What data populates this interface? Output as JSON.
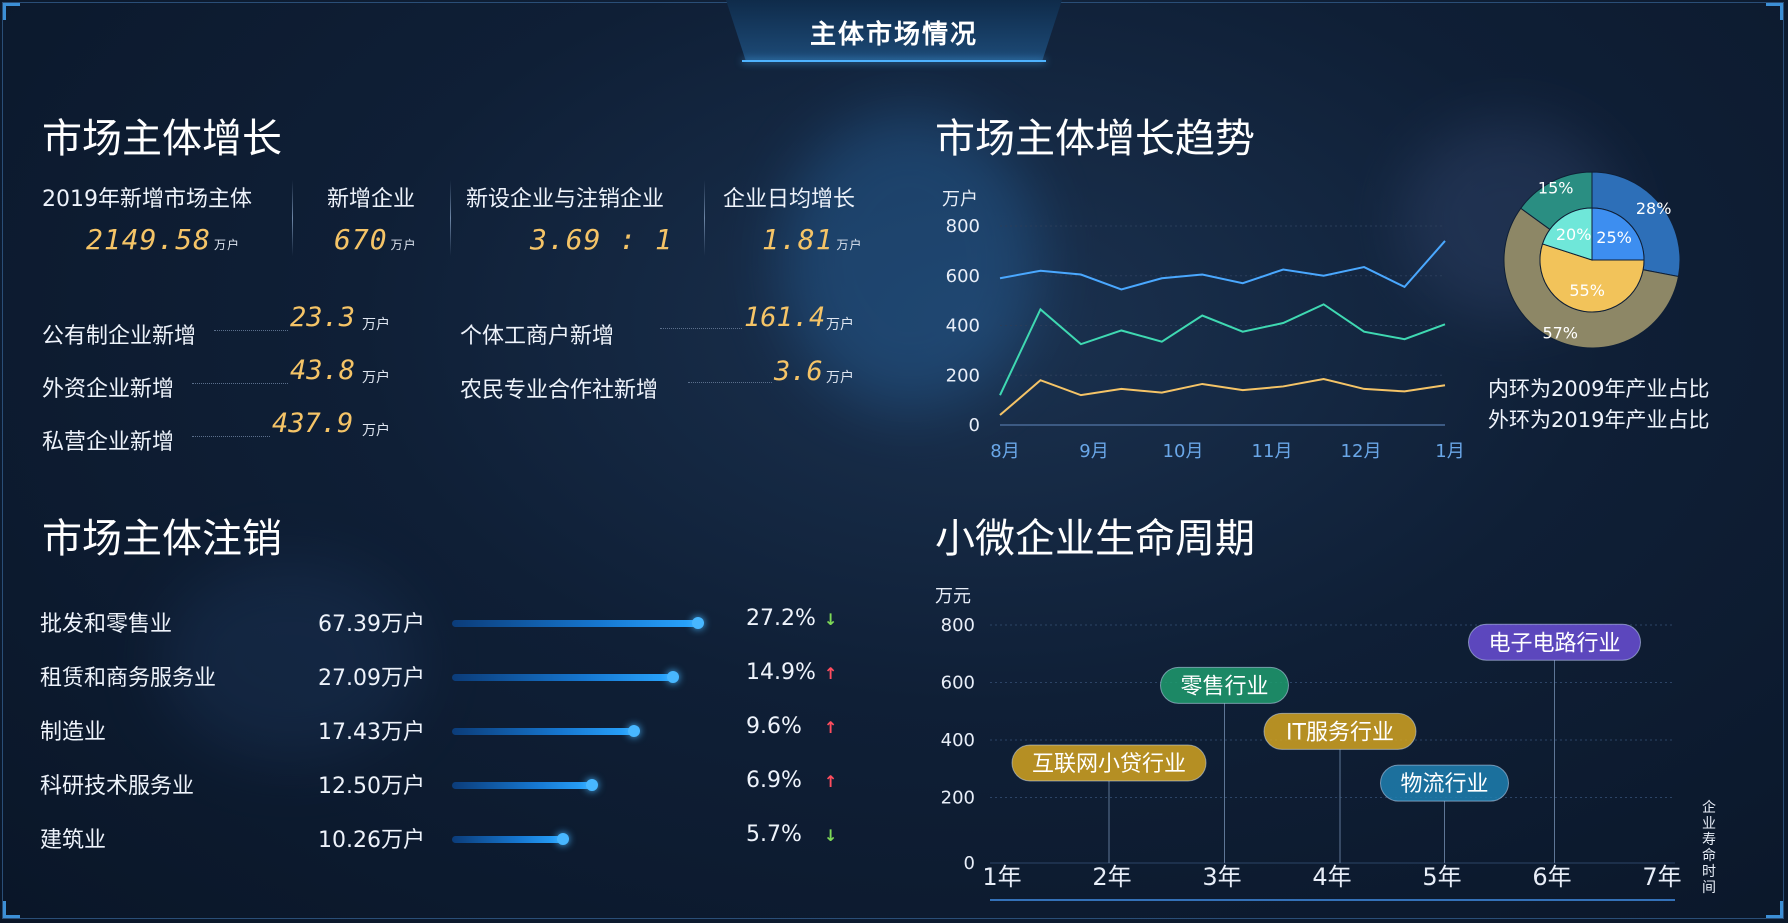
{
  "header": {
    "title": "主体市场情况"
  },
  "growth": {
    "title": "市场主体增长",
    "stats": [
      {
        "label": "2019年新增市场主体",
        "value": "2149.58",
        "unit": "万户"
      },
      {
        "label": "新增企业",
        "value": "670",
        "unit": "万户"
      },
      {
        "label": "新设企业与注销企业",
        "value": "3.69 : 1",
        "unit": ""
      },
      {
        "label": "企业日均增长",
        "value": "1.81",
        "unit": "万户"
      }
    ],
    "breakdown": [
      {
        "label": "公有制企业新增",
        "value": "23.3",
        "unit": "万户"
      },
      {
        "label": "外资企业新增",
        "value": "43.8",
        "unit": "万户"
      },
      {
        "label": "私营企业新增",
        "value": "437.9",
        "unit": "万户"
      },
      {
        "label": "个体工商户新增",
        "value": "161.4",
        "unit": "万户"
      },
      {
        "label": "农民专业合作社新增",
        "value": "3.6",
        "unit": "万户"
      }
    ]
  },
  "deregistration": {
    "title": "市场主体注销",
    "colors": {
      "up": "#ff4d5e",
      "down": "#7ed957"
    },
    "items": [
      {
        "label": "批发和零售业",
        "value": "67.39万户",
        "pct": "27.2%",
        "trend": "down",
        "level": 1.0
      },
      {
        "label": "租赁和商务服务业",
        "value": "27.09万户",
        "pct": "14.9%",
        "trend": "up",
        "level": 0.9
      },
      {
        "label": "制造业",
        "value": "17.43万户",
        "pct": "9.6%",
        "trend": "up",
        "level": 0.74
      },
      {
        "label": "科研技术服务业",
        "value": "12.50万户",
        "pct": "6.9%",
        "trend": "up",
        "level": 0.57
      },
      {
        "label": "建筑业",
        "value": "10.26万户",
        "pct": "5.7%",
        "trend": "down",
        "level": 0.45
      }
    ]
  },
  "trend": {
    "title": "市场主体增长趋势",
    "legend_inner": "内环为2009年产业占比",
    "legend_outer": "外环为2019年产业占比"
  },
  "lifecycle": {
    "title": "小微企业生命周期"
  },
  "chart_data": [
    {
      "type": "line",
      "ylabel": "万户",
      "ylim": [
        0,
        800
      ],
      "yticks": [
        0,
        200,
        400,
        600,
        800
      ],
      "x": [
        0,
        1,
        2,
        3,
        4,
        5,
        6,
        7,
        8,
        9,
        10,
        11,
        12,
        13,
        14,
        15
      ],
      "xtick_positions": [
        0,
        3,
        6,
        9,
        12,
        15
      ],
      "xtick_labels": [
        "8月",
        "9月",
        "10月",
        "11月",
        "12月",
        "1月"
      ],
      "colors": [
        "#4aa8ff",
        "#3fd9b2",
        "#f5c467"
      ],
      "series": [
        {
          "values": [
            590,
            620,
            605,
            545,
            590,
            605,
            570,
            625,
            600,
            635,
            555,
            740
          ]
        },
        {
          "values": [
            120,
            465,
            325,
            380,
            335,
            440,
            375,
            410,
            485,
            375,
            345,
            405
          ]
        },
        {
          "values": [
            40,
            180,
            120,
            145,
            130,
            165,
            140,
            155,
            185,
            145,
            135,
            160
          ]
        }
      ]
    },
    {
      "type": "pie",
      "inner": {
        "labels": [
          "25%",
          "55%",
          "20%"
        ],
        "values": [
          25,
          55,
          20
        ],
        "colors": [
          "#3d8ef0",
          "#f2c35a",
          "#6fe7d9"
        ]
      },
      "outer": {
        "labels": [
          "28%",
          "57%",
          "15%"
        ],
        "values": [
          28,
          57,
          15
        ],
        "colors": [
          "#2d6fb8",
          "#8d8766",
          "#2a8e82"
        ]
      }
    },
    {
      "type": "scatter",
      "ylabel": "万元",
      "ylim": [
        0,
        800
      ],
      "yticks": [
        0,
        200,
        400,
        600,
        800
      ],
      "xlim": [
        1,
        7
      ],
      "xticks": [
        1,
        2,
        3,
        4,
        5,
        6,
        7
      ],
      "xtick_labels": [
        "1年",
        "2年",
        "3年",
        "4年",
        "5年",
        "6年",
        "7年"
      ],
      "xlabel": "企业寿命时间",
      "points": [
        {
          "name": "互联网小贷行业",
          "x": 1.9,
          "y": 320,
          "color": "#d2a321"
        },
        {
          "name": "零售行业",
          "x": 2.95,
          "y": 590,
          "color": "#1f9b6d"
        },
        {
          "name": "IT服务行业",
          "x": 4.0,
          "y": 430,
          "color": "#d2a321"
        },
        {
          "name": "物流行业",
          "x": 4.95,
          "y": 250,
          "color": "#1f7fb0"
        },
        {
          "name": "电子电路行业",
          "x": 5.95,
          "y": 740,
          "color": "#6a4fd6"
        }
      ]
    }
  ]
}
